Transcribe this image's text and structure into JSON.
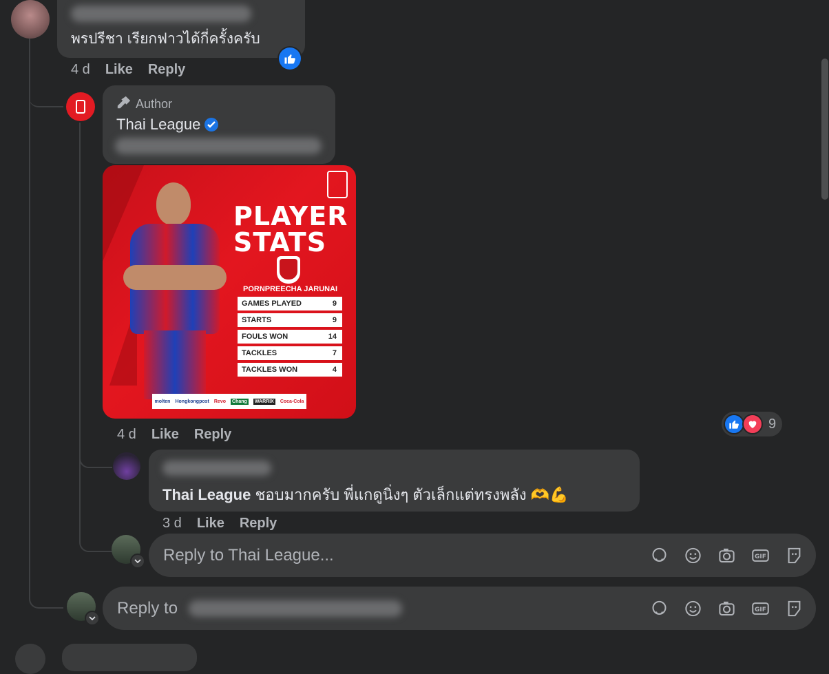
{
  "comment1": {
    "text": "พรปรีชา เรียกฟาวได้กี่ครั้งครับ",
    "time": "4 d",
    "like": "Like",
    "reply": "Reply"
  },
  "author_reply": {
    "badge": "Author",
    "name": "Thai League",
    "time": "4 d",
    "like": "Like",
    "reply": "Reply",
    "reaction_count": "9",
    "image": {
      "title_line1": "PLAYER",
      "title_line2": "STATS",
      "player": "PORNPREECHA JARUNAI",
      "stats": [
        {
          "label": "GAMES PLAYED",
          "value": "9"
        },
        {
          "label": "STARTS",
          "value": "9"
        },
        {
          "label": "FOULS WON",
          "value": "14"
        },
        {
          "label": "TACKLES",
          "value": "7"
        },
        {
          "label": "TACKLES WON",
          "value": "4"
        }
      ],
      "sponsors": [
        "molten",
        "Hongkongpost",
        "Revo",
        "Chang",
        "WARRIX",
        "Coca-Cola"
      ]
    }
  },
  "nested_reply": {
    "mention": "Thai League",
    "text": " ชอบมากครับ พี่แกดูนิ่งๆ ตัวเล็กแต่ทรงพลัง 🫶💪",
    "time": "3 d",
    "like": "Like",
    "reply": "Reply"
  },
  "reply_box_1": {
    "placeholder": "Reply to Thai League..."
  },
  "reply_box_2": {
    "placeholder": "Reply to"
  },
  "colors": {
    "like_blue": "#1877f2",
    "heart_red": "#f33e58",
    "verified": "#1b74e4"
  }
}
